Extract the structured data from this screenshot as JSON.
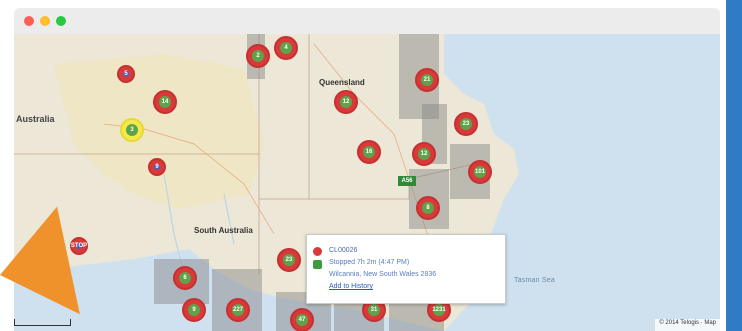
{
  "labels": {
    "country": "Australia",
    "queensland": "Queensland",
    "south_australia": "South Australia",
    "tasman_sea": "Tasman Sea"
  },
  "popup": {
    "id": "CL00026",
    "status": "Stopped 7h 2m (4:47 PM)",
    "location": "Wilcannia, New South Wales 2836",
    "action": "Add to History"
  },
  "markers": [
    {
      "label": "3",
      "kind": "red"
    },
    {
      "label": "5",
      "kind": "red"
    },
    {
      "label": "14",
      "kind": "red"
    },
    {
      "label": "9",
      "kind": "red"
    },
    {
      "label": "21",
      "kind": "red"
    },
    {
      "label": "2",
      "kind": "red"
    },
    {
      "label": "4",
      "kind": "red"
    },
    {
      "label": "12",
      "kind": "red"
    },
    {
      "label": "16",
      "kind": "red"
    },
    {
      "label": "23",
      "kind": "red"
    },
    {
      "label": "101",
      "kind": "red"
    },
    {
      "label": "A56",
      "kind": "badge"
    },
    {
      "label": "8",
      "kind": "red"
    },
    {
      "label": "6",
      "kind": "red"
    },
    {
      "label": "9",
      "kind": "red"
    },
    {
      "label": "227",
      "kind": "red"
    },
    {
      "label": "47",
      "kind": "red"
    },
    {
      "label": "31",
      "kind": "red"
    },
    {
      "label": "1231",
      "kind": "red"
    },
    {
      "label": "STOP",
      "kind": "stop"
    }
  ],
  "footer": "© 2014 Telogis · Map",
  "colors": {
    "sea": "#cfe1ee",
    "land": "#ece7d6",
    "desert": "#efe6c5",
    "marker_outer": "#d83a3a",
    "marker_inner": "#5ea34a",
    "marker_yellow": "#f5e94a",
    "marker_blue": "#4b61c2",
    "accent": "#2f7bc4",
    "orange": "#f0922b"
  }
}
